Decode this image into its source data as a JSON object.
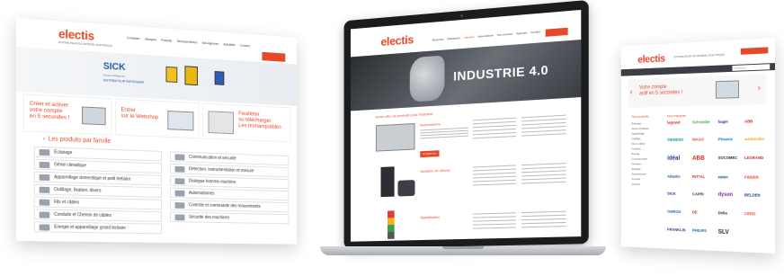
{
  "left_panel": {
    "logo": "electis",
    "tagline": "DISTRIBUTEUR DE MATÉRIEL ÉLECTRIQUE",
    "nav": [
      "Contactez",
      "Marques",
      "Produits",
      "Services/Ventes",
      "Nos Agences",
      "Actualités",
      "Contact"
    ],
    "banner_brand": "SICK",
    "banner_sub": "Sensor Intelligence.",
    "banner_tag": "DISTRIBUTEUR PARTENAIRE",
    "promo1_lines": [
      "Créer et activer",
      "votre compte",
      "en 5 secondes !"
    ],
    "promo2_lines": [
      "Entrer",
      "sur le Webshop"
    ],
    "promo3_lines": [
      "Feuilleter",
      "ou télécharger",
      "Les Immanquables"
    ],
    "section_title": "Les produits par famille",
    "families_left": [
      "Éclairage",
      "Génie climatique",
      "Appareillage domestique et petit tertiaire",
      "Outillage, fixation, divers",
      "Fils et câbles",
      "Conduits et Chemin de câbles",
      "Énergie et appareillage grand tertiaire"
    ],
    "families_right": [
      "Communication et sécurité",
      "Détection, instrumentation et mesure",
      "Dialogue homme-machine",
      "Automatismes",
      "Contrôle et commande des mouvements",
      "Sécurité des machines"
    ]
  },
  "laptop": {
    "logo": "electis",
    "nav": [
      "Électricité",
      "Distribution",
      "Industrie",
      "Automatisme",
      "Nos services",
      "Agences",
      "Contact"
    ],
    "hero_text": "INDUSTRIE 4.0",
    "offer_title": "Notre offre de produits pour l'industrie",
    "cat1": "Automatisme",
    "cat2": "Variation de vitesse",
    "cat3": "Signalisation",
    "cta": "En savoir plus"
  },
  "right_panel": {
    "logo": "electis",
    "tagline": "DISTRIBUTEUR DE MATÉRIEL ÉLECTRIQUE",
    "nav_search_placeholder": "Recherche",
    "promo_lines": [
      "Votre compte",
      "actif en 5 secondes !"
    ],
    "menu_title": "Nos produits",
    "brands_title": "Nos marques",
    "brands": [
      "legrand",
      "Schneider",
      "hager",
      "ABB",
      "SIEMENS",
      "WAGO",
      "Phoenix",
      "weidmüller",
      "idéal",
      "ABB",
      "SOCOMEC",
      "LEGRAND",
      "Atlantic",
      "RITTAL",
      "eaton",
      "FINDER",
      "SICK",
      "CAPRI",
      "dyson",
      "BELDEN",
      "OMRON",
      "DE",
      "Delta",
      "CEDO",
      "FRANKLIN",
      "PHILIPS",
      "SLV"
    ],
    "menu_items": [
      "Éclairage",
      "Génie climatique",
      "Appareillage",
      "Outillage",
      "Fils et câbles",
      "Conduits",
      "Énergie",
      "Communication",
      "Détection",
      "Dialogue",
      "Automatismes",
      "Contrôle",
      "Sécurité"
    ]
  },
  "colors": {
    "accent": "#e8482a",
    "text": "#333333",
    "border": "#e1e1e1"
  }
}
